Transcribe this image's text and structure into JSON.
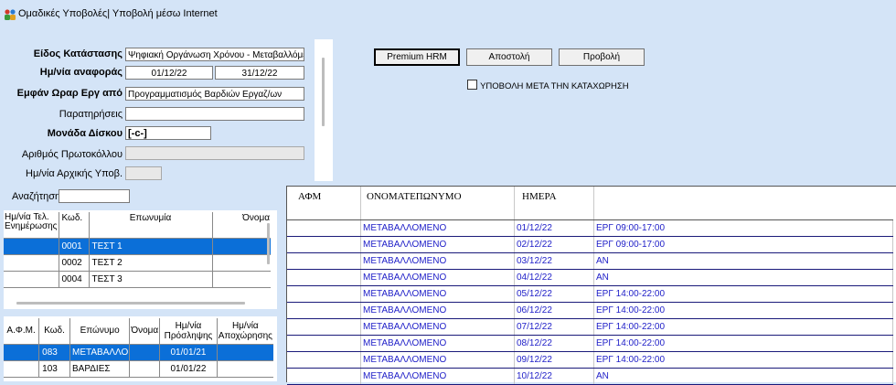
{
  "window": {
    "title": "Ομαδικές Υποβολές| Υποβολή μέσω Internet",
    "icon": "app-people-icon"
  },
  "form": {
    "status_type_label": "Είδος Κατάστασης",
    "status_type_value": "Ψηφιακή Οργάνωση Χρόνου - Μεταβαλλόμενο",
    "ref_date_label": "Ημ/νία αναφοράς",
    "ref_date_from": "01/12/22",
    "ref_date_to": "31/12/22",
    "show_hours_label": "Εμφάν Ωραρ Εργ από",
    "show_hours_value": "Προγραμματισμός Βαρδιών Εργαζ/ων",
    "remarks_label": "Παρατηρήσεις",
    "remarks_value": "",
    "disk_unit_label": "Μονάδα Δίσκου",
    "disk_unit_value": "[-c-]",
    "protocol_label": "Αριθμός Πρωτοκόλλου",
    "protocol_value": "",
    "initial_date_label": "Ημ/νία Αρχικής Υποβ.",
    "initial_date_value": ""
  },
  "toolbar": {
    "premium_label": "Premium HRM",
    "send_label": "Αποστολή",
    "preview_label": "Προβολή",
    "submit_after_label": "ΥΠΟΒΟΛΗ ΜΕΤΑ ΤΗΝ ΚΑΤΑΧΩΡΗΣΗ",
    "submit_after_checked": false
  },
  "search": {
    "label": "Αναζήτηση",
    "value": ""
  },
  "companies": {
    "headers": [
      "Ημ/νία Τελ. Ενημέρωσης",
      "Κωδ.",
      "Επωνυμία",
      "Όνομα"
    ],
    "rows": [
      {
        "date": "",
        "code": "0001",
        "name": "ΤΕΣΤ 1",
        "first": "",
        "selected": true
      },
      {
        "date": "",
        "code": "0002",
        "name": "ΤΕΣΤ 2",
        "first": "",
        "selected": false
      },
      {
        "date": "",
        "code": "0004",
        "name": "ΤΕΣΤ 3",
        "first": "",
        "selected": false
      }
    ]
  },
  "employees": {
    "headers": [
      "Α.Φ.Μ.",
      "Κωδ.",
      "Επώνυμο",
      "Όνομα",
      "Ημ/νία Πρόσληψης",
      "Ημ/νία Αποχώρησης"
    ],
    "rows": [
      {
        "afm": "",
        "code": "083",
        "surname": "ΜΕΤΑΒΑΛΛΟ",
        "name": "",
        "hire": "01/01/21",
        "leave": "",
        "selected": true
      },
      {
        "afm": "",
        "code": "103",
        "surname": "ΒΑΡΔΙΕΣ",
        "name": "",
        "hire": "01/01/22",
        "leave": "",
        "selected": false
      }
    ]
  },
  "schedule": {
    "headers": [
      "ΑΦΜ",
      "ΟΝΟΜΑΤΕΠΩΝΥΜΟ",
      "ΗΜΕΡΑ",
      ""
    ],
    "rows": [
      {
        "afm": "",
        "name": "ΜΕΤΑΒΑΛΛΟΜΕΝΟ",
        "day": "01/12/22",
        "shift": "ΕΡΓ 09:00-17:00"
      },
      {
        "afm": "",
        "name": "ΜΕΤΑΒΑΛΛΟΜΕΝΟ",
        "day": "02/12/22",
        "shift": "ΕΡΓ 09:00-17:00"
      },
      {
        "afm": "",
        "name": "ΜΕΤΑΒΑΛΛΟΜΕΝΟ",
        "day": "03/12/22",
        "shift": "ΑΝ"
      },
      {
        "afm": "",
        "name": "ΜΕΤΑΒΑΛΛΟΜΕΝΟ",
        "day": "04/12/22",
        "shift": "ΑΝ"
      },
      {
        "afm": "",
        "name": "ΜΕΤΑΒΑΛΛΟΜΕΝΟ",
        "day": "05/12/22",
        "shift": "ΕΡΓ 14:00-22:00"
      },
      {
        "afm": "",
        "name": "ΜΕΤΑΒΑΛΛΟΜΕΝΟ",
        "day": "06/12/22",
        "shift": "ΕΡΓ 14:00-22:00"
      },
      {
        "afm": "",
        "name": "ΜΕΤΑΒΑΛΛΟΜΕΝΟ",
        "day": "07/12/22",
        "shift": "ΕΡΓ 14:00-22:00"
      },
      {
        "afm": "",
        "name": "ΜΕΤΑΒΑΛΛΟΜΕΝΟ",
        "day": "08/12/22",
        "shift": "ΕΡΓ 14:00-22:00"
      },
      {
        "afm": "",
        "name": "ΜΕΤΑΒΑΛΛΟΜΕΝΟ",
        "day": "09/12/22",
        "shift": "ΕΡΓ 14:00-22:00"
      },
      {
        "afm": "",
        "name": "ΜΕΤΑΒΑΛΛΟΜΕΝΟ",
        "day": "10/12/22",
        "shift": "ΑΝ"
      }
    ]
  },
  "colors": {
    "background": "#d4e4f7",
    "selection": "#0b6fd8",
    "grid_text": "#2020c8"
  }
}
